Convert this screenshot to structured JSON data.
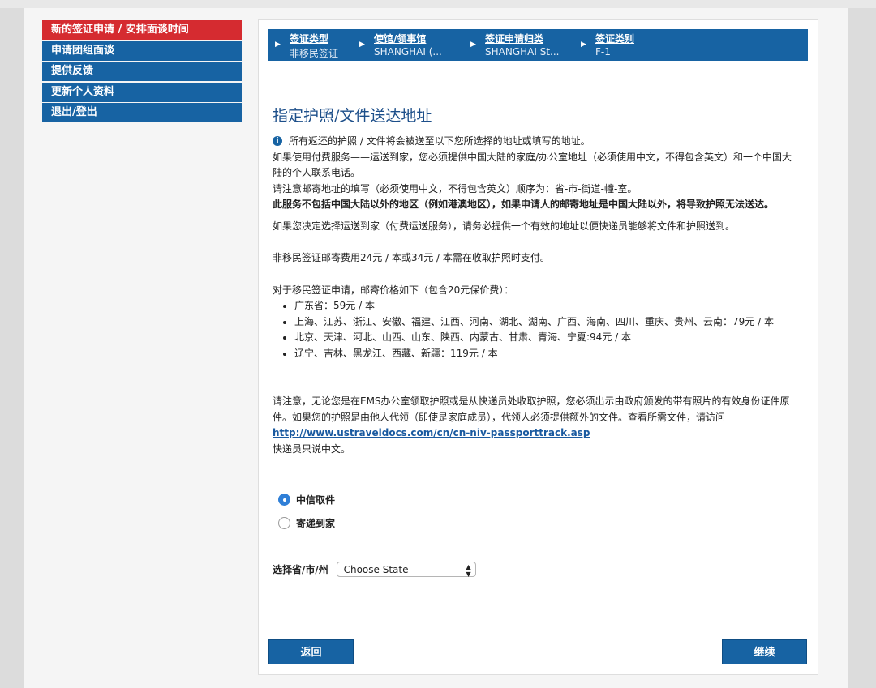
{
  "sidebar": {
    "items": [
      {
        "label": "新的签证申请 / 安排面谈时间"
      },
      {
        "label": "申请团组面谈"
      },
      {
        "label": "提供反馈"
      },
      {
        "label": "更新个人资料"
      },
      {
        "label": "退出/登出"
      }
    ]
  },
  "steps": [
    {
      "title": "签证类型",
      "value": "非移民签证"
    },
    {
      "title": "使馆/领事馆",
      "value": "SHANGHAI (..."
    },
    {
      "title": "签证申请归类",
      "value": "SHANGHAI St..."
    },
    {
      "title": "签证类别",
      "value": "F-1"
    }
  ],
  "main": {
    "heading": "指定护照/文件送达地址",
    "info_line": "所有返还的护照 / 文件将会被送至以下您所选择的地址或填写的地址。",
    "para1": "如果使用付费服务——运送到家，您必须提供中国大陆的家庭/办公室地址（必须使用中文，不得包含英文）和一个中国大陆的个人联系电话。",
    "para2": "请注意邮寄地址的填写（必须使用中文，不得包含英文）顺序为：省-市-街道-幢-室。",
    "para3_bold": "此服务不包括中国大陆以外的地区（例如港澳地区），如果申请人的邮寄地址是中国大陆以外，将导致护照无法送达。",
    "para4": "如果您决定选择运送到家（付费运送服务），请务必提供一个有效的地址以便快递员能够将文件和护照送到。",
    "para5": "非移民签证邮寄费用24元 / 本或34元 / 本需在收取护照时支付。",
    "para6": "对于移民签证申请，邮寄价格如下（包含20元保价费）：",
    "prices": [
      "广东省：59元 / 本",
      "上海、江苏、浙江、安徽、福建、江西、河南、湖北、湖南、广西、海南、四川、重庆、贵州、云南：79元 / 本",
      "北京、天津、河北、山西、山东、陕西、内蒙古、甘肃、青海、宁夏:94元 / 本",
      "辽宁、吉林、黑龙江、西藏、新疆：119元 / 本"
    ],
    "para7": "请注意，无论您是在EMS办公室领取护照或是从快递员处收取护照，您必须出示由政府颁发的带有照片的有效身份证件原件。如果您的护照是由他人代领（即使是家庭成员），代领人必须提供额外的文件。查看所需文件，请访问",
    "link": "http://www.ustraveldocs.com/cn/cn-niv-passporttrack.asp",
    "para8": "快递员只说中文。",
    "radio_options": [
      {
        "label": "中信取件",
        "checked": true
      },
      {
        "label": "寄递到家",
        "checked": false
      }
    ],
    "select_label": "选择省/市/州",
    "select_value": "Choose State",
    "back_label": "返回",
    "continue_label": "继续"
  },
  "colors": {
    "primary": "#1763a3",
    "active": "#d52b30",
    "heading": "#1d4f8a"
  },
  "icons": {
    "info": "info-icon",
    "step_arrow": "triangle-right-icon",
    "select_arrows": "up-down-arrows-icon"
  }
}
